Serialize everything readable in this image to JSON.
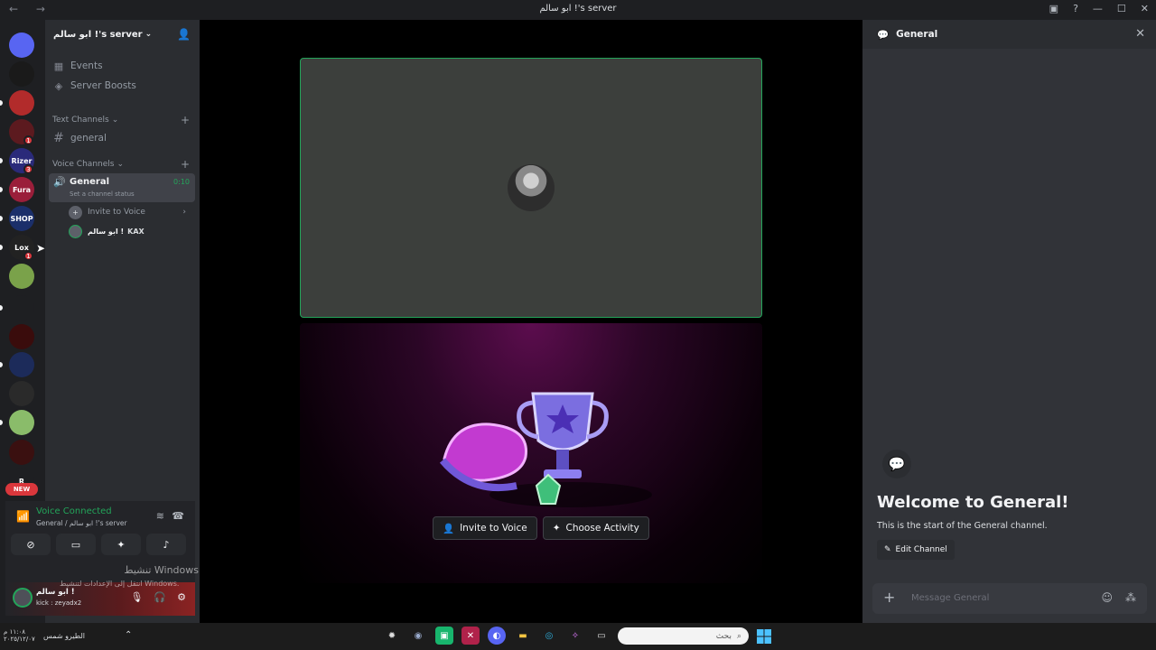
{
  "window": {
    "title": "ابو سالم !'s server",
    "nav": "← →"
  },
  "server": {
    "name": "ابو سالم !'s server"
  },
  "sidebar": {
    "items": [
      {
        "label": "Events"
      },
      {
        "label": "Server Boosts"
      }
    ],
    "text_category": "Text Channels",
    "text_channels": [
      "general"
    ],
    "voice_category": "Voice Channels",
    "voice_channel": {
      "name": "General",
      "status": "Set a channel status",
      "timer": "0:10"
    },
    "invite_label": "Invite to Voice",
    "member": {
      "name": "ابو سالم !",
      "tag": "KAX"
    }
  },
  "server_icons": [
    {
      "label": "",
      "color": "#5865f2"
    },
    {
      "label": "",
      "color": "#1a1a1a"
    },
    {
      "label": "",
      "color": "#b22b2b"
    },
    {
      "label": "",
      "color": "#5c1a1f",
      "badge": "1"
    },
    {
      "label": "Rizer",
      "color": "#2a2a7a",
      "badge": "3"
    },
    {
      "label": "Fura",
      "color": "#9a1e3a"
    },
    {
      "label": "SHOP",
      "color": "#1b2f6a"
    },
    {
      "label": "Lox",
      "color": "#222",
      "badge": "1"
    },
    {
      "label": "",
      "color": "#7aa24a"
    },
    {
      "label": "",
      "color": "#1e1f22"
    },
    {
      "label": "",
      "color": "#3a0c0c"
    },
    {
      "label": "",
      "color": "#1c2b5a"
    },
    {
      "label": "",
      "color": "#2a2a2a"
    },
    {
      "label": "",
      "color": "#8abc6a"
    },
    {
      "label": "",
      "color": "#3a1010"
    },
    {
      "label": "R",
      "color": "#1e1f22"
    }
  ],
  "new_badge": "NEW",
  "voice_panel": {
    "status": "Voice Connected",
    "channel": "General / ابو سالم !'s server"
  },
  "user": {
    "name": "ابو سالم !",
    "status": "kick : zeyadx2"
  },
  "watermark": {
    "line1": "تنشيط Windows",
    "line2": "انتقل إلى الإعدادات لتنشيط Windows."
  },
  "stage": {
    "invite_label": "Invite to Voice",
    "activity_label": "Choose Activity"
  },
  "chat": {
    "header": "General",
    "welcome": "Welcome to General!",
    "subtitle": "This is the start of the General channel.",
    "edit_label": "Edit Channel",
    "placeholder": "Message General"
  },
  "taskbar": {
    "time": "١١:٠٨ م",
    "date": "٢٠٢٥/١٢/٠٧",
    "weather": "الطيرو شمس",
    "search_placeholder": "بحث"
  }
}
